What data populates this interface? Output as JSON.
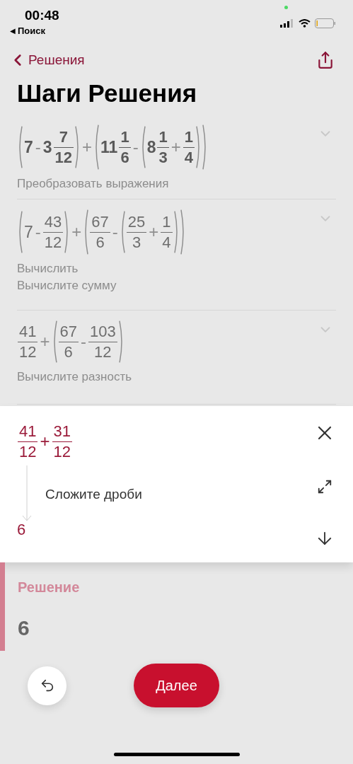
{
  "status_bar": {
    "time": "00:48",
    "back_glyph": "◀",
    "back_label": "Поиск"
  },
  "nav": {
    "back_label": "Решения"
  },
  "title": "Шаги Решения",
  "steps": [
    {
      "bold": true,
      "expression": [
        {
          "kind": "group",
          "items": [
            {
              "kind": "num",
              "text": "7"
            },
            {
              "kind": "op",
              "text": "-"
            },
            {
              "kind": "num",
              "text": "3"
            },
            {
              "kind": "frac",
              "num": "7",
              "den": "12"
            }
          ]
        },
        {
          "kind": "op",
          "text": "+"
        },
        {
          "kind": "group",
          "items": [
            {
              "kind": "num",
              "text": "11"
            },
            {
              "kind": "frac",
              "num": "1",
              "den": "6"
            },
            {
              "kind": "op",
              "text": "-"
            },
            {
              "kind": "group",
              "items": [
                {
                  "kind": "num",
                  "text": "8"
                },
                {
                  "kind": "frac",
                  "num": "1",
                  "den": "3"
                },
                {
                  "kind": "op",
                  "text": "+"
                },
                {
                  "kind": "frac",
                  "num": "1",
                  "den": "4"
                }
              ]
            }
          ]
        }
      ],
      "captions": [
        "Преобразовать выражения"
      ]
    },
    {
      "bold": false,
      "expression": [
        {
          "kind": "group",
          "items": [
            {
              "kind": "num",
              "text": "7"
            },
            {
              "kind": "op",
              "text": "-"
            },
            {
              "kind": "frac",
              "num": "43",
              "den": "12"
            }
          ]
        },
        {
          "kind": "op",
          "text": "+"
        },
        {
          "kind": "group",
          "items": [
            {
              "kind": "frac",
              "num": "67",
              "den": "6"
            },
            {
              "kind": "op",
              "text": "-"
            },
            {
              "kind": "group",
              "items": [
                {
                  "kind": "frac",
                  "num": "25",
                  "den": "3"
                },
                {
                  "kind": "op",
                  "text": "+"
                },
                {
                  "kind": "frac",
                  "num": "1",
                  "den": "4"
                }
              ]
            }
          ]
        }
      ],
      "captions": [
        "Вычислить",
        "Вычислите сумму"
      ]
    },
    {
      "bold": false,
      "expression": [
        {
          "kind": "frac",
          "num": "41",
          "den": "12"
        },
        {
          "kind": "op",
          "text": "+"
        },
        {
          "kind": "group",
          "items": [
            {
              "kind": "frac",
              "num": "67",
              "den": "6"
            },
            {
              "kind": "op",
              "text": "-"
            },
            {
              "kind": "frac",
              "num": "103",
              "den": "12"
            }
          ]
        }
      ],
      "captions": [
        "Вычислите разность"
      ]
    }
  ],
  "current_step": {
    "expression": [
      {
        "kind": "frac",
        "num": "41",
        "den": "12"
      },
      {
        "kind": "op",
        "text": "+"
      },
      {
        "kind": "frac",
        "num": "31",
        "den": "12"
      }
    ],
    "caption": "Сложите дроби",
    "result": "6"
  },
  "solution": {
    "label": "Решение",
    "value": "6"
  },
  "next_button": "Далее"
}
